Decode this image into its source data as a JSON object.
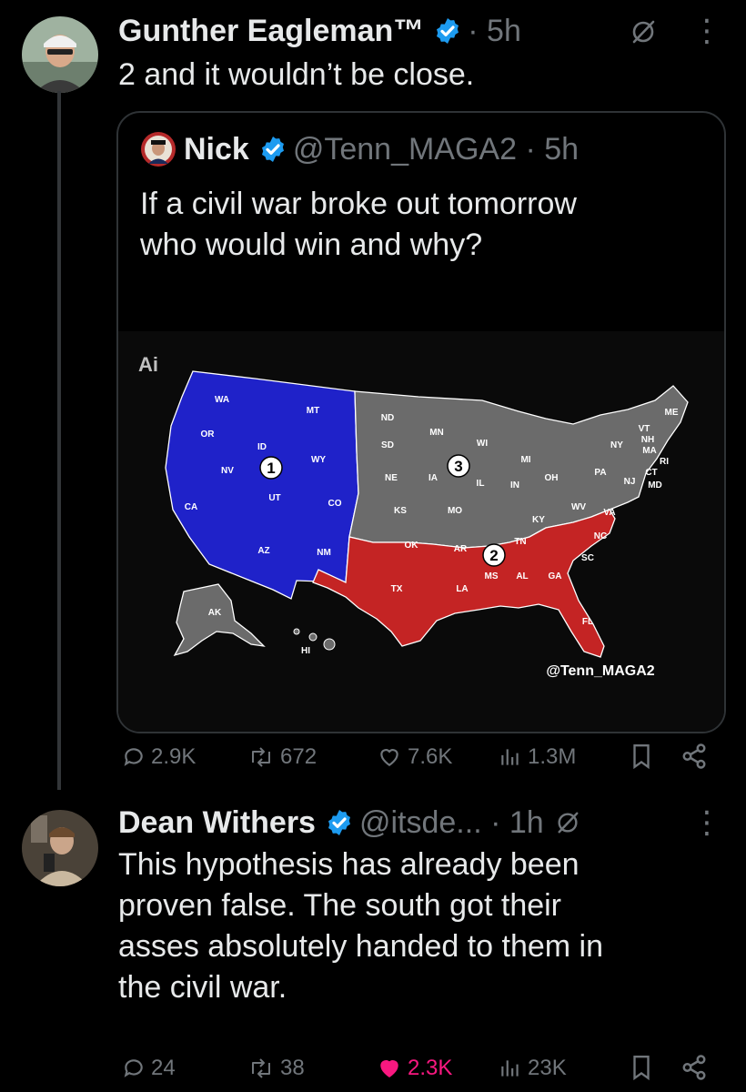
{
  "theme": {
    "background": "#000000",
    "text": "#e7e9ea",
    "muted": "#71767b",
    "verified_blue": "#1d9bf0",
    "like_pink": "#f91880",
    "union_blue": "#1f22c9",
    "confederate_red": "#c42424",
    "neutral_gray": "#6b6b6b"
  },
  "tweet1": {
    "author_name": "Gunther Eagleman™",
    "separator_time": "· 5h",
    "text": "2 and it wouldn’t be close.",
    "quote": {
      "author_name": "Nick",
      "handle_time": "@Tenn_MAGA2 · 5h",
      "text_line1": "If a civil war broke out tomorrow",
      "text_line2": "who would win and why?",
      "image": {
        "ai_badge": "Ai",
        "watermark": "@Tenn_MAGA2",
        "region_markers": [
          "1",
          "2",
          "3"
        ],
        "state_labels": [
          "WA",
          "OR",
          "CA",
          "NV",
          "ID",
          "MT",
          "WY",
          "UT",
          "CO",
          "AZ",
          "NM",
          "AK",
          "HI",
          "ND",
          "SD",
          "NE",
          "KS",
          "MN",
          "IA",
          "MO",
          "WI",
          "IL",
          "MI",
          "IN",
          "OH",
          "PA",
          "NY",
          "ME",
          "VT",
          "NH",
          "MA",
          "RI",
          "CT",
          "NJ",
          "MD",
          "OK",
          "TX",
          "AR",
          "LA",
          "MS",
          "AL",
          "TN",
          "KY",
          "WV",
          "VA",
          "NC",
          "SC",
          "GA",
          "FL"
        ]
      }
    },
    "actions": {
      "replies": "2.9K",
      "reposts": "672",
      "likes": "7.6K",
      "views": "1.3M"
    }
  },
  "tweet2": {
    "author_name": "Dean Withers",
    "handle_time": "@itsde... · 1h",
    "text_lines": [
      "This hypothesis has already been",
      "proven false. The south got their",
      "asses absolutely handed to them in",
      "the civil war."
    ],
    "actions": {
      "replies": "24",
      "reposts": "38",
      "likes": "2.3K",
      "views": "23K"
    }
  },
  "icons": [
    "verified-badge-icon",
    "grok-icon",
    "more-icon",
    "reply-icon",
    "repost-icon",
    "like-icon",
    "views-icon",
    "bookmark-icon",
    "share-icon"
  ]
}
